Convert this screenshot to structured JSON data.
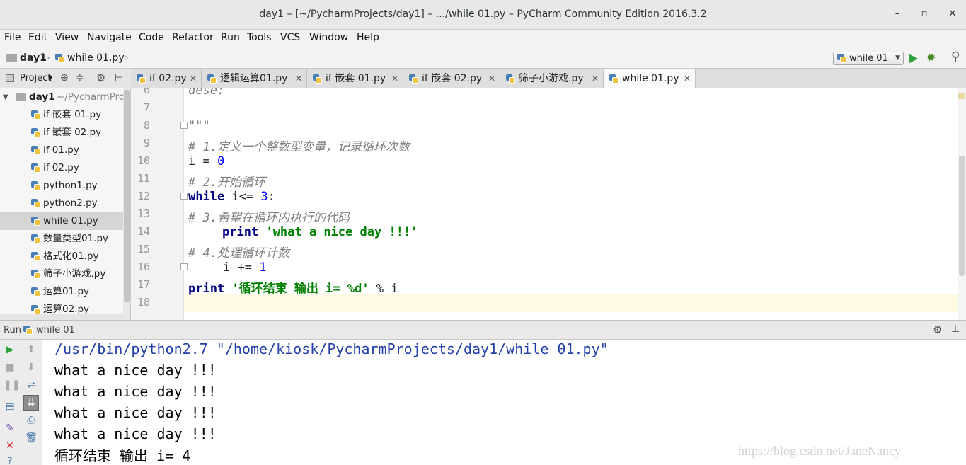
{
  "window": {
    "title": "day1 – [~/PycharmProjects/day1] – .../while 01.py – PyCharm Community Edition 2016.3.2",
    "minimize": "–",
    "maximize": "▫",
    "close": "✕"
  },
  "menu": [
    "File",
    "Edit",
    "View",
    "Navigate",
    "Code",
    "Refactor",
    "Run",
    "Tools",
    "VCS",
    "Window",
    "Help"
  ],
  "breadcrumb": {
    "project": "day1",
    "file": "while 01.py"
  },
  "run_config": {
    "label": "while 01"
  },
  "project_panel": {
    "label": "Project",
    "root": {
      "name": "day1",
      "path": "~/PycharmProje"
    },
    "files": [
      "if 嵌套 01.py",
      "if 嵌套 02.py",
      "if 01.py",
      "if 02.py",
      "python1.py",
      "python2.py",
      "while 01.py",
      "数量类型01.py",
      "格式化01.py",
      "筛子小游戏.py",
      "运算01.py",
      "运算02.py"
    ],
    "selected": "while 01.py"
  },
  "tabs": [
    {
      "label": "if 02.py",
      "active": false
    },
    {
      "label": "逻辑运算01.py",
      "active": false
    },
    {
      "label": "if 嵌套 01.py",
      "active": false
    },
    {
      "label": "if 嵌套 02.py",
      "active": false
    },
    {
      "label": "筛子小游戏.py",
      "active": false
    },
    {
      "label": "while 01.py",
      "active": true
    }
  ],
  "editor": {
    "line_numbers": [
      "6",
      "7",
      "8",
      "9",
      "10",
      "11",
      "12",
      "13",
      "14",
      "15",
      "16",
      "17",
      "18"
    ],
    "partial_top": "dese:",
    "lines": {
      "l8": "\"\"\"",
      "l9": "# 1.定义一个整数型变量，记录循环次数",
      "l10_var": "i",
      "l10_op": " = ",
      "l10_num": "0",
      "l11": "# 2.开始循环",
      "l12_kw": "while",
      "l12_cond": " i<= ",
      "l12_num": "3",
      "l12_colon": ":",
      "l13": "# 3.希望在循环内执行的代码",
      "l14_kw": "print",
      "l14_str": "'what a nice day !!!'",
      "l15": "# 4.处理循环计数",
      "l16_var": "i",
      "l16_op": " += ",
      "l16_num": "1",
      "l17_kw": "print",
      "l17_str": "'循环结束 输出 i= %d'",
      "l17_rest": " % i"
    }
  },
  "run_panel": {
    "label": "Run",
    "config": "while 01",
    "output": [
      "/usr/bin/python2.7 \"/home/kiosk/PycharmProjects/day1/while 01.py\"",
      "what a nice day !!!",
      "what a nice day !!!",
      "what a nice day !!!",
      "what a nice day !!!",
      "循环结束 输出 i= 4"
    ]
  },
  "watermark": "https://blog.csdn.net/JaneNancy",
  "colors": {
    "keyword": "#000080",
    "number": "#0000ff",
    "string": "#008000",
    "comment": "#808080",
    "console_cmd": "#2340a8"
  }
}
